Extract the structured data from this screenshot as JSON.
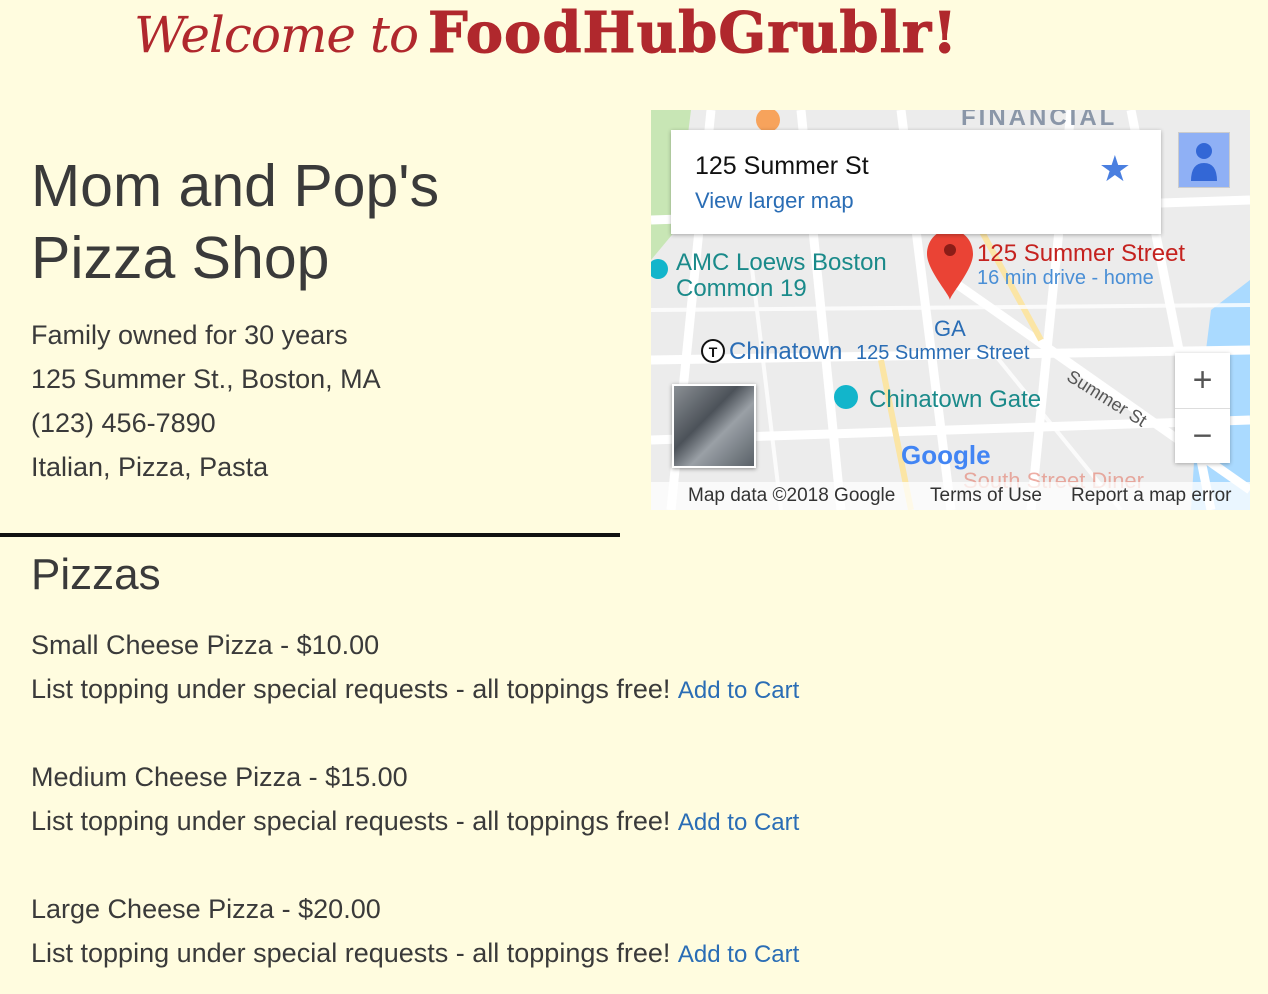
{
  "banner": {
    "welcome": "Welcome to",
    "brand": "FoodHubGrublr!"
  },
  "restaurant": {
    "name_line1": "Mom and Pop's",
    "name_line2": "Pizza Shop",
    "tagline": "Family owned for 30 years",
    "address": "125 Summer St., Boston, MA",
    "phone": "(123) 456-7890",
    "cuisine": "Italian, Pizza, Pasta"
  },
  "map": {
    "card_address": "125 Summer St",
    "view_larger": "View larger map",
    "pin_title": "125 Summer Street",
    "pin_sub": "16 min drive - home",
    "labels": {
      "financial": "FINANCIAL",
      "amc_1": "AMC Loews Boston",
      "amc_2": "Common 19",
      "chinatown": "Chinatown",
      "summer_street": "125 Summer Street",
      "ga": "GA",
      "chinatown_gate": "Chinatown Gate",
      "summer_st_road": "Summer St",
      "google": "Google",
      "south_street": "South Street Diner"
    },
    "zoom_in": "+",
    "zoom_out": "−",
    "footer": {
      "data": "Map data ©2018 Google",
      "terms": "Terms of Use",
      "report": "Report a map error"
    },
    "colors": {
      "road": "#ffffff",
      "land": "#ececec",
      "water": "#aadaff",
      "park": "#c8e6b5",
      "pin": "#ea4335"
    }
  },
  "menu": {
    "section_title": "Pizzas",
    "items": [
      {
        "name": "Small Cheese Pizza - $10.00",
        "desc": "List topping under special requests - all toppings free!",
        "action": "Add to Cart"
      },
      {
        "name": "Medium Cheese Pizza - $15.00",
        "desc": "List topping under special requests - all toppings free!",
        "action": "Add to Cart"
      },
      {
        "name": "Large Cheese Pizza - $20.00",
        "desc": "List topping under special requests - all toppings free!",
        "action": "Add to Cart"
      }
    ]
  },
  "colors": {
    "background": "#fffcdf",
    "brand_red": "#b0282d",
    "link_blue": "#2a6db5",
    "text": "#3a3a3a"
  }
}
